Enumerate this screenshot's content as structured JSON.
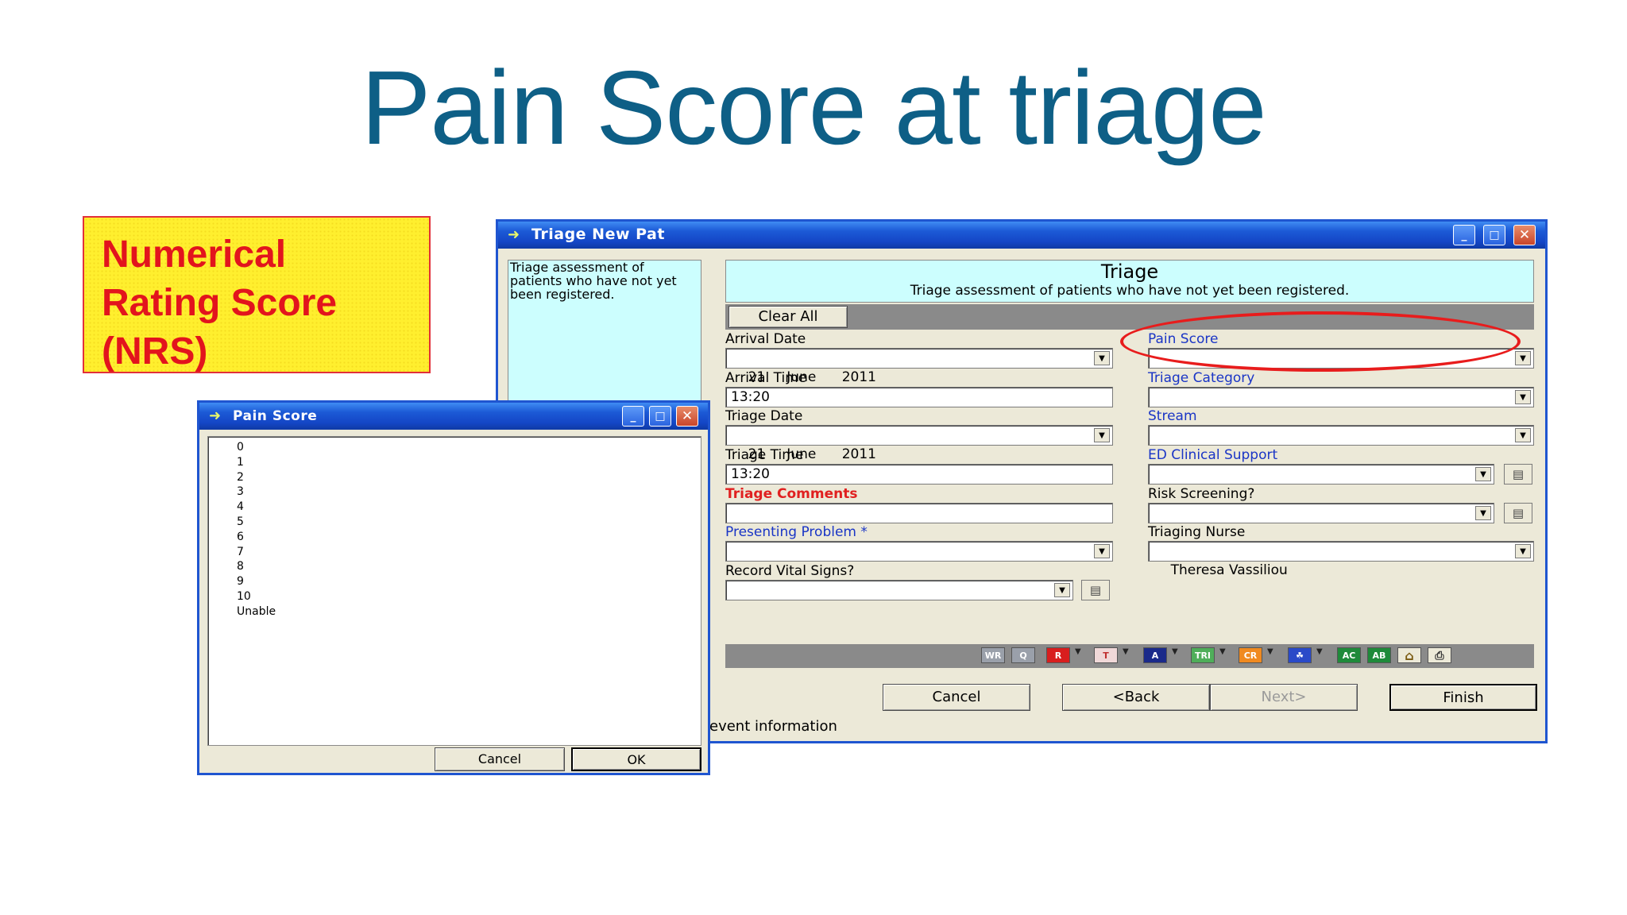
{
  "slide": {
    "title": "Pain Score at triage",
    "note_lines": [
      "Numerical",
      "Rating Score",
      "(NRS)"
    ]
  },
  "triage_window": {
    "title": "Triage New Pat",
    "side_text": "Triage assessment of patients who have not yet been registered.",
    "header_title": "Triage",
    "header_subtitle": "Triage assessment of patients who have not yet been registered.",
    "clear_all": "Clear All",
    "left_fields": {
      "arrival_date": {
        "label": "Arrival Date",
        "value": "21     June      2011"
      },
      "arrival_time": {
        "label": "Arrival Time",
        "value": "13:20"
      },
      "triage_date": {
        "label": "Triage Date",
        "value": "21     June      2011"
      },
      "triage_time": {
        "label": "Triage Time",
        "value": "13:20"
      },
      "triage_comments": {
        "label": "Triage Comments",
        "value": ""
      },
      "presenting_problem": {
        "label": "Presenting Problem *",
        "value": ""
      },
      "record_vital_signs": {
        "label": "Record Vital Signs?",
        "value": ""
      }
    },
    "right_fields": {
      "pain_score": {
        "label": "Pain Score",
        "value": ""
      },
      "triage_category": {
        "label": "Triage Category",
        "value": ""
      },
      "stream": {
        "label": "Stream",
        "value": ""
      },
      "ed_clinical_support": {
        "label": "ED Clinical Support",
        "value": ""
      },
      "risk_screening": {
        "label": "Risk Screening?",
        "value": ""
      },
      "triaging_nurse": {
        "label": "Triaging Nurse",
        "value": "Theresa Vassiliou"
      }
    },
    "toolbar": [
      "WR",
      "Q",
      "R",
      "T",
      "A",
      "TRI",
      "CR",
      "AC",
      "AB"
    ],
    "buttons": {
      "cancel": "Cancel",
      "back": "<Back",
      "next": "Next>",
      "finish": "Finish"
    },
    "status": "event information",
    "colors": {
      "highlight_ellipse": "#e81c1c",
      "title_bar": "#1446c6"
    }
  },
  "pain_dialog": {
    "title": "Pain Score",
    "options": [
      "0",
      "1",
      "2",
      "3",
      "4",
      "5",
      "6",
      "7",
      "8",
      "9",
      "10",
      "Unable"
    ],
    "selected": "0",
    "cancel": "Cancel",
    "ok": "OK"
  }
}
